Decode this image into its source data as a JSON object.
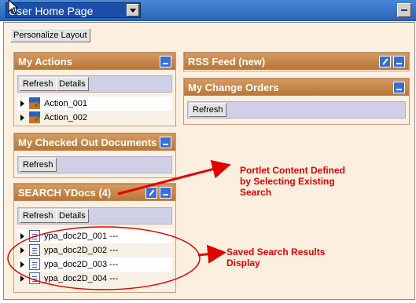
{
  "page_selector": {
    "value": "User Home Page"
  },
  "personalize_label": "Personalize Layout",
  "portlets": {
    "my_actions": {
      "title": "My Actions",
      "refresh": "Refresh",
      "details": "Details",
      "items": [
        "Action_001",
        "Action_002"
      ]
    },
    "rss_feed": {
      "title": "RSS Feed (new)"
    },
    "change_orders": {
      "title": "My Change Orders",
      "refresh": "Refresh"
    },
    "checked_out": {
      "title": "My Checked Out Documents",
      "refresh": "Refresh"
    },
    "search_ydocs": {
      "title": "SEARCH YDocs (4)",
      "refresh": "Refresh",
      "details": "Details",
      "items": [
        "ypa_doc2D_001 ---",
        "ypa_doc2D_002 ---",
        "ypa_doc2D_003 ---",
        "ypa_doc2D_004 ---"
      ]
    }
  },
  "annotations": {
    "portlet_content": [
      "Portlet Content Defined",
      "by Selecting Existing",
      "Search"
    ],
    "saved_search": [
      "Saved Search Results",
      "Display"
    ]
  },
  "colors": {
    "accent_red": "#e00000",
    "title_orange": "#c9874a",
    "top_blue": "#2a63b8"
  }
}
